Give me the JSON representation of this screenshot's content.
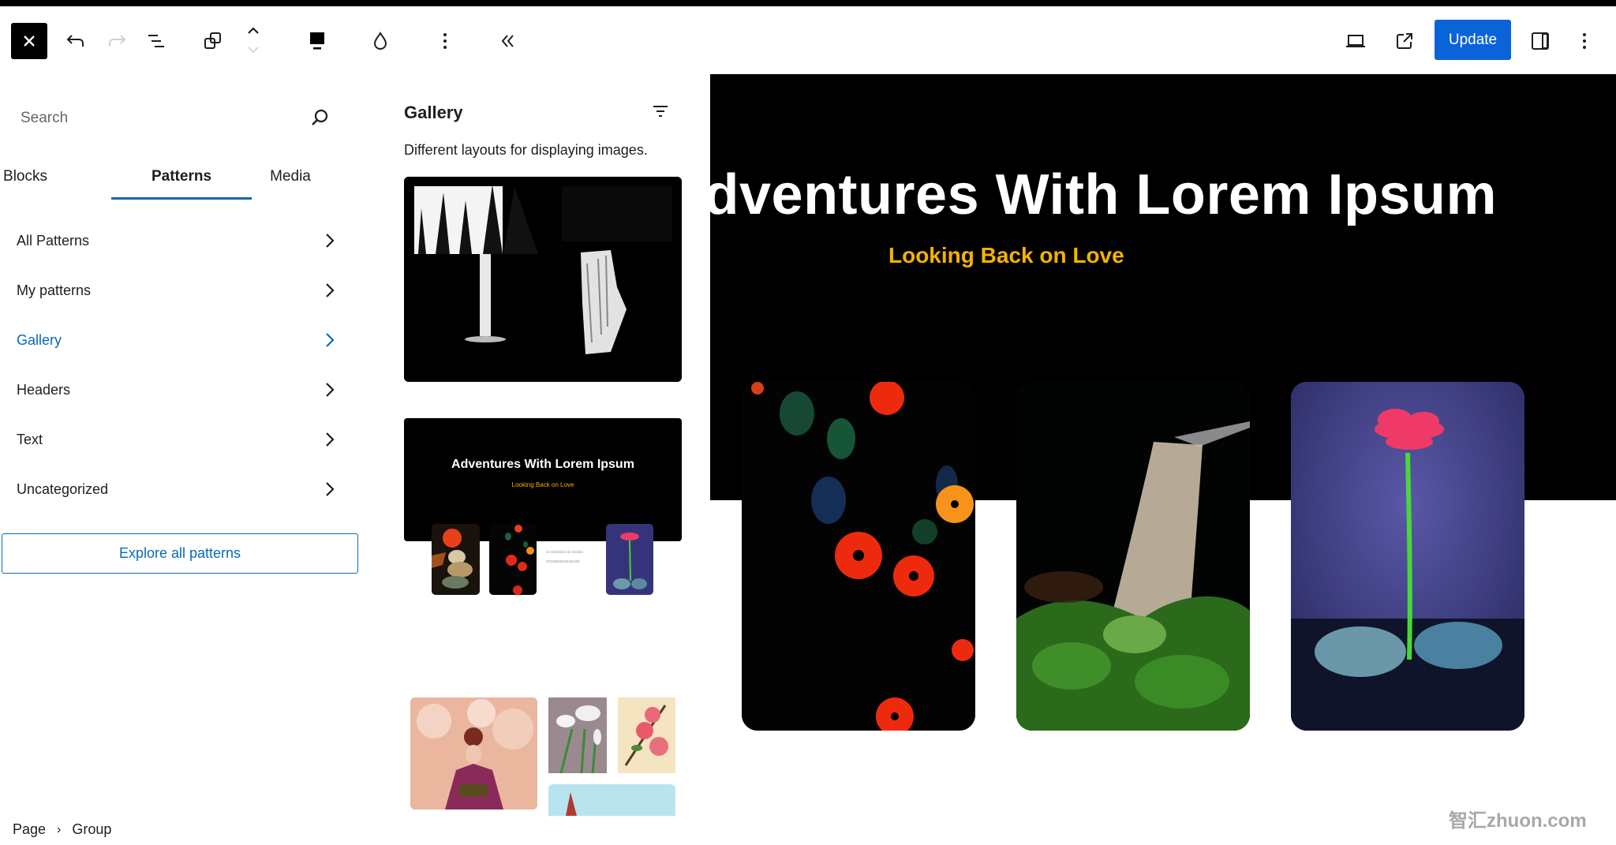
{
  "toolbar": {
    "close_icon": "close-icon",
    "undo_icon": "undo-icon",
    "redo_icon": "redo-icon",
    "list_view_icon": "list-view-icon",
    "block_icon": "duplicate-block-icon",
    "move_up_icon": "chevron-up-icon",
    "move_down_icon": "chevron-down-icon",
    "align_icon": "block-align-icon",
    "color_icon": "droplet-icon",
    "more_icon": "more-vertical-icon",
    "collapse_icon": "double-chevron-left-icon",
    "preview_icon": "desktop-preview-icon",
    "view_icon": "external-link-icon",
    "update_label": "Update",
    "settings_icon": "sidebar-toggle-icon",
    "options_icon": "more-vertical-icon"
  },
  "inserter": {
    "search_placeholder": "Search",
    "tabs": [
      {
        "label": "Blocks",
        "active": false
      },
      {
        "label": "Patterns",
        "active": true
      },
      {
        "label": "Media",
        "active": false
      }
    ],
    "categories": [
      {
        "label": "All Patterns",
        "active": false
      },
      {
        "label": "My patterns",
        "active": false
      },
      {
        "label": "Gallery",
        "active": true
      },
      {
        "label": "Headers",
        "active": false
      },
      {
        "label": "Text",
        "active": false
      },
      {
        "label": "Uncategorized",
        "active": false
      }
    ],
    "explore_label": "Explore all patterns"
  },
  "pattern_panel": {
    "title": "Gallery",
    "description": "Different layouts for displaying images.",
    "preview2": {
      "title": "Adventures With Lorem Ipsum",
      "subtitle": "Looking Back on Love"
    }
  },
  "canvas": {
    "hero_title": "Adventures With Lorem Ipsum",
    "hero_subtitle": "Looking Back on Love",
    "accent_color": "#f5b301"
  },
  "breadcrumb": {
    "items": [
      "Page",
      "Group"
    ],
    "separator": "›"
  },
  "watermark": "智汇zhuon.com",
  "colors": {
    "primary": "#0a63d8",
    "link": "#0a6ab6"
  }
}
